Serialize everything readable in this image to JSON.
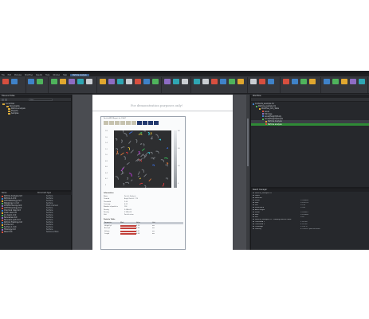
{
  "menu": {
    "items": [
      "File",
      "Edit",
      "Modules",
      "Workflow",
      "Results",
      "Tools",
      "Window",
      "Help",
      "Particle analysis"
    ],
    "active_index": 8
  },
  "document": {
    "header_text": "For demonstration purposes only!",
    "report_title": "ParticleMFM Report for 19667"
  },
  "report": {
    "section_title": "Information",
    "properties": [
      {
        "key": "Name",
        "value": "Particle Analysis"
      },
      {
        "key": "Created",
        "value": "Angle Particle 1 19"
      },
      {
        "key": "Threshold",
        "value": "2.00"
      },
      {
        "key": "Coverage",
        "value": "4.05"
      },
      {
        "key": "Number of particles",
        "value": "234"
      },
      {
        "key": "Density",
        "value": "3.06E+05"
      },
      {
        "key": "Density",
        "value": "3.99E+08"
      },
      {
        "key": "Unit",
        "value": "Particles/mm"
      }
    ],
    "table_section": "Particle Table",
    "table_headers": [
      "Parameter",
      "Mark",
      "Value",
      "Unit"
    ],
    "table_rows": [
      {
        "name": "Height (p)",
        "value": "0.10",
        "unit": "nm"
      },
      {
        "name": "Area (p)",
        "value": "0.99",
        "unit": "nm"
      },
      {
        "name": "Volume",
        "value": "0.01",
        "unit": "nm"
      },
      {
        "name": "Length",
        "value": "0.58",
        "unit": "nm"
      }
    ],
    "y_ticks": [
      "1.8",
      "1.6",
      "1.4",
      "1.2",
      "1.0",
      "0.8",
      "0.6",
      "0.4",
      "0.2",
      "0"
    ],
    "colorbar_ticks": [
      "3.0",
      "2.0",
      "1.0",
      "0"
    ]
  },
  "left_panel": {
    "title": "Files and Sites",
    "search_placeholder": "Filter",
    "tree": [
      "Local Disk",
      "Documents",
      "Particle analysis",
      "Projects",
      "Samples"
    ],
    "list_headers": [
      "Name",
      "Document type"
    ],
    "files": [
      {
        "name": "Particle Analysis.mnt",
        "type": "Surface"
      },
      {
        "name": "Particle A.mnt",
        "type": "Surface"
      },
      {
        "name": "AFM Metallurgy.mnt",
        "type": "Surface"
      },
      {
        "name": "Metallurgy 1.mnt",
        "type": "Surface"
      },
      {
        "name": "AFM/Microscopy.mnt",
        "type": "Multi channel"
      },
      {
        "name": "AFM Mineralogy.mnt",
        "type": "Surface"
      },
      {
        "name": "Chemical map.mnt",
        "type": "Surface"
      },
      {
        "name": "Grain size.mnt",
        "type": "Surface"
      },
      {
        "name": "Ion beam.mnt",
        "type": "Surface"
      },
      {
        "name": "Nanowires.mnt",
        "type": "Surface"
      },
      {
        "name": "Nanowire part.mnt",
        "type": "Surface"
      },
      {
        "name": "Particle Tracking.mnt",
        "type": "Surface"
      },
      {
        "name": "Profile.mnt",
        "type": "Surface"
      },
      {
        "name": "Surface 1.mnt",
        "type": "Surface"
      },
      {
        "name": "Tribology.mnt",
        "type": "Surface"
      },
      {
        "name": "Wear.mnt",
        "type": "Series surface"
      }
    ]
  },
  "workflow": {
    "title": "Workflow",
    "rows": [
      {
        "label": "Contents_example 01",
        "indent": 0
      },
      {
        "label": "Particle_example 01",
        "indent": 1
      },
      {
        "label": "Workflow_Info_Table",
        "indent": 2
      },
      {
        "label": "Level",
        "indent": 3
      },
      {
        "label": "Fill holes",
        "indent": 3
      },
      {
        "label": "Level(Height)Study",
        "indent": 3
      },
      {
        "label": "Level(Height)Sample",
        "indent": 3
      },
      {
        "label": "Particle Analysis",
        "indent": 4
      },
      {
        "label": "Particle analysis",
        "indent": 4
      }
    ],
    "highlight_index": 8
  },
  "result_manager": {
    "title": "Result manager",
    "rows": [
      {
        "key": "Particle_example 01",
        "value": ""
      },
      {
        "key": "Layer",
        "value": ""
      },
      {
        "key": "Particles",
        "value": ""
      },
      {
        "key": "Mean",
        "value": "0.188849"
      },
      {
        "key": "Max",
        "value": "0.209753"
      },
      {
        "key": "Min",
        "value": "0.134"
      },
      {
        "key": "Mean Area",
        "value": "0.184"
      },
      {
        "key": "Area length",
        "value": ""
      },
      {
        "key": "Mean",
        "value": "0.098867"
      },
      {
        "key": "Max",
        "value": "0.399649"
      },
      {
        "key": "Min",
        "value": "0.09"
      },
      {
        "key": "Particle_example 01 - Landing Particle table",
        "value": ""
      },
      {
        "key": "Threshold 1",
        "value": "2.00 nm"
      },
      {
        "key": "Threshold 2",
        "value": "4.00 nm"
      },
      {
        "key": "Coverage",
        "value": "11.24 %"
      },
      {
        "key": "Density",
        "value": "8.79E+01 particles/mm²"
      }
    ]
  },
  "colors": {
    "accent": "#3a5d8a",
    "highlight": "#2f8b36",
    "swatch_light": "#c6c2ae",
    "swatch_dark": "#22386e"
  }
}
